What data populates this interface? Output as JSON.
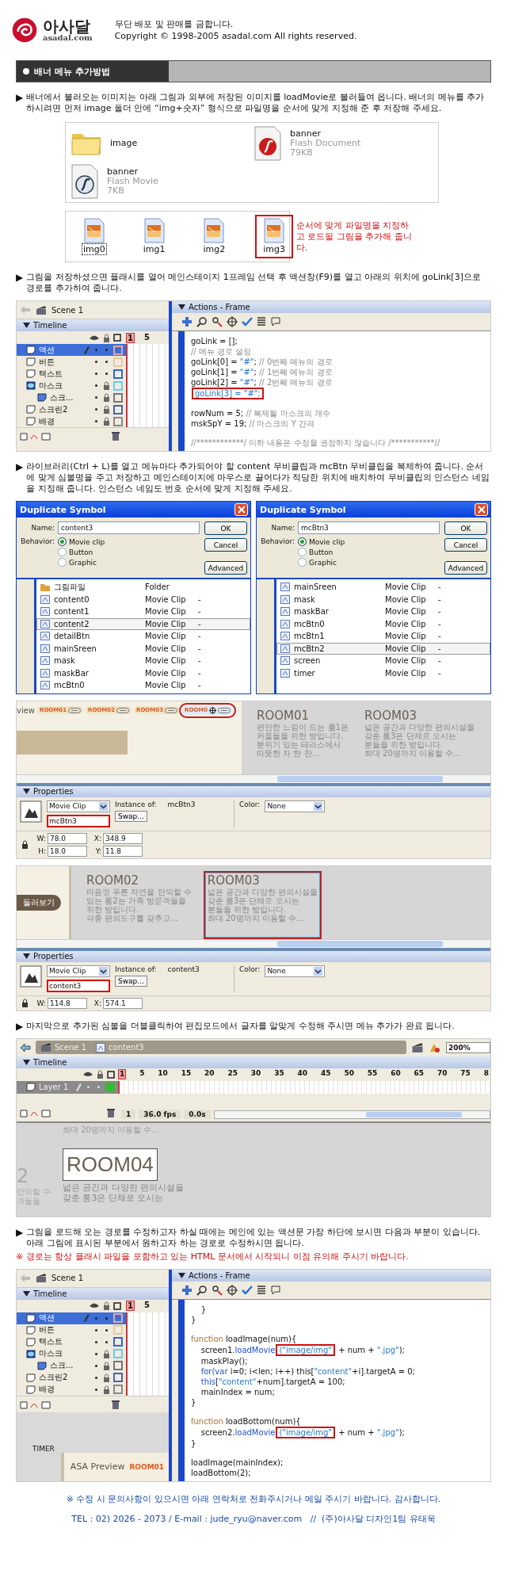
{
  "header": {
    "logo": "아사달",
    "domain": "asadal.com",
    "notice": "무단 배포 및 판매를 금합니다.",
    "copyright": "Copyright © 1998-2005 asadal.com All rights reserved."
  },
  "section_title": "배너 메뉴 추가방법",
  "steps": [
    {
      "bullet": "▶",
      "text": "배너에서 불러오는 이미지는 아래 그림과 외부에 저장된 이미지를 loadMovie로 불러들여 옵니다. 배너의 메뉴를 추가하시려면 먼저 image 폴더 안에 “img+숫자” 형식으로 파일명을 순서에 맞게 지정해 준 후 저장해 주세요.",
      "figures": [
        {
          "kind": "files",
          "items": [
            {
              "kind": "folder",
              "name": "image"
            },
            {
              "kind": "document",
              "name": "banner",
              "type": "Flash Document",
              "size": "79KB"
            },
            {
              "kind": "movie",
              "name": "banner",
              "type": "Flash Movie",
              "size": "7KB"
            }
          ]
        },
        {
          "kind": "images",
          "note": "순서에 맞게 파일명을 지정하고 로드될 그림을 추가해 줍니다.",
          "items": [
            {
              "name": "img0",
              "focused": true,
              "highlighted": false
            },
            {
              "name": "img1",
              "focused": false,
              "highlighted": false
            },
            {
              "name": "img2",
              "focused": false,
              "highlighted": false
            },
            {
              "name": "img3",
              "focused": false,
              "highlighted": true
            }
          ]
        }
      ]
    },
    {
      "bullet": "▶",
      "text": "그림을 저장하셨으면 플래시를 열어 메인스테이지 1프레임 선택 후 액션창(F9)를 열고 아래의 위치에 goLink[3]으로 경로를 추가하여 줍니다.",
      "figures": [
        {
          "kind": "flash_actions",
          "scene": "Scene 1",
          "timeline_title": "Timeline",
          "frame_marks": [
            "1",
            "5"
          ],
          "actions_title": "Actions - Frame",
          "layers": [
            {
              "name": "액션",
              "kind": "layer",
              "selected": true,
              "locked": false,
              "color": "#e0a8a8"
            },
            {
              "name": "버튼",
              "kind": "layer",
              "selected": false,
              "locked": false,
              "color": "#e8c8a0"
            },
            {
              "name": "텍스트",
              "kind": "layer",
              "selected": false,
              "locked": false,
              "color": "#3366cc"
            },
            {
              "name": "마스크",
              "kind": "mask",
              "selected": false,
              "locked": true,
              "color": "#66ccee"
            },
            {
              "name": "스크...",
              "kind": "masked",
              "selected": false,
              "locked": true,
              "color": "#777777"
            },
            {
              "name": "스크린2",
              "kind": "layer",
              "selected": false,
              "locked": true,
              "color": "#4466aa"
            },
            {
              "name": "배경",
              "kind": "layer",
              "selected": false,
              "locked": true,
              "color": "#888888"
            }
          ],
          "code": [
            {
              "segments": [
                {
                  "kind": "code",
                  "text": "goLink = [];"
                }
              ]
            },
            {
              "segments": [
                {
                  "kind": "comment",
                  "text": "// 메뉴 경로 설정"
                }
              ]
            },
            {
              "segments": [
                {
                  "kind": "code",
                  "text": "goLink[0] = "
                },
                {
                  "kind": "string",
                  "text": "\"#\""
                },
                {
                  "kind": "code",
                  "text": "; "
                },
                {
                  "kind": "comment",
                  "text": "// 0번째 메뉴의 경로"
                }
              ]
            },
            {
              "segments": [
                {
                  "kind": "code",
                  "text": "goLink[1] = "
                },
                {
                  "kind": "string",
                  "text": "\"#\""
                },
                {
                  "kind": "code",
                  "text": "; "
                },
                {
                  "kind": "comment",
                  "text": "// 1번째 메뉴의 경로"
                }
              ]
            },
            {
              "segments": [
                {
                  "kind": "code",
                  "text": "goLink[2] = "
                },
                {
                  "kind": "string",
                  "text": "\"#\""
                },
                {
                  "kind": "code",
                  "text": "; "
                },
                {
                  "kind": "comment",
                  "text": "// 2번째 메뉴의 경로"
                }
              ]
            },
            {
              "segments": [
                {
                  "kind": "boxed",
                  "text": "goLink[3] = \"#\";"
                }
              ]
            },
            {
              "gap_before": true,
              "segments": [
                {
                  "kind": "code",
                  "text": "rowNum = 5; "
                },
                {
                  "kind": "comment",
                  "text": "// 복제될 마스크의 개수"
                }
              ]
            },
            {
              "segments": [
                {
                  "kind": "code",
                  "text": "mskSpY = 19; "
                },
                {
                  "kind": "comment",
                  "text": "// 마스크의 Y 간격"
                }
              ]
            },
            {
              "gap_before": true,
              "segments": [
                {
                  "kind": "comment",
                  "text": "//************/ 이하 내용은 수정을 권장하지 않습니다 /***********//"
                }
              ]
            }
          ]
        }
      ]
    },
    {
      "bullet": "▶",
      "text": "라이브러리(Ctrl + L)를 열고 메뉴마다 추가되어야 할 content 무비클립과 mcBtn 무비클립을 복제하여 줍니다. 순서에 맞게 심볼명을 주고 저장하고 메인스테이지에 마우스로 끌어다가 적당한 위치에 배치하여 무비클립의 인스턴스 네임을 지정해 줍니다. 인스턴스 네임도 번호 순서에 맞게 지정해 주세요.",
      "figures": [
        {
          "kind": "dialogs",
          "dialogs": [
            {
              "title": "Duplicate Symbol",
              "name_label": "Name:",
              "name_value": "content3",
              "behavior_label": "Behavior:",
              "buttons": [
                "OK",
                "Cancel",
                "Advanced"
              ],
              "behaviors": [
                {
                  "label": "Movie clip",
                  "selected": true
                },
                {
                  "label": "Button",
                  "selected": false
                },
                {
                  "label": "Graphic",
                  "selected": false
                }
              ],
              "library": [
                {
                  "kind": "folder",
                  "name": "그림파일",
                  "type": "Folder",
                  "selected": false
                },
                {
                  "kind": "clip",
                  "name": "content0",
                  "type": "Movie Clip",
                  "usage": "-",
                  "selected": false
                },
                {
                  "kind": "clip",
                  "name": "content1",
                  "type": "Movie Clip",
                  "usage": "-",
                  "selected": false
                },
                {
                  "kind": "clip",
                  "name": "content2",
                  "type": "Movie Clip",
                  "usage": "-",
                  "selected": true
                },
                {
                  "kind": "clip",
                  "name": "detailBtn",
                  "type": "Movie Clip",
                  "usage": "-",
                  "selected": false
                },
                {
                  "kind": "clip",
                  "name": "mainSreen",
                  "type": "Movie Clip",
                  "usage": "-",
                  "selected": false
                },
                {
                  "kind": "clip",
                  "name": "mask",
                  "type": "Movie Clip",
                  "usage": "-",
                  "selected": false
                },
                {
                  "kind": "clip",
                  "name": "maskBar",
                  "type": "Movie Clip",
                  "usage": "-",
                  "selected": false
                },
                {
                  "kind": "clip",
                  "name": "mcBtn0",
                  "type": "Movie Clip",
                  "usage": "-",
                  "selected": false
                }
              ]
            },
            {
              "title": "Duplicate Symbol",
              "name_label": "Name:",
              "name_value": "mcBtn3",
              "behavior_label": "Behavior:",
              "buttons": [
                "OK",
                "Cancel",
                "Advanced"
              ],
              "behaviors": [
                {
                  "label": "Movie clip",
                  "selected": true
                },
                {
                  "label": "Button",
                  "selected": false
                },
                {
                  "label": "Graphic",
                  "selected": false
                }
              ],
              "library": [
                {
                  "kind": "clip",
                  "name": "mainSreen",
                  "type": "Movie Clip",
                  "usage": "-",
                  "selected": false
                },
                {
                  "kind": "clip",
                  "name": "mask",
                  "type": "Movie Clip",
                  "usage": "-",
                  "selected": false
                },
                {
                  "kind": "clip",
                  "name": "maskBar",
                  "type": "Movie Clip",
                  "usage": "-",
                  "selected": false
                },
                {
                  "kind": "clip",
                  "name": "mcBtn0",
                  "type": "Movie Clip",
                  "usage": "-",
                  "selected": false
                },
                {
                  "kind": "clip",
                  "name": "mcBtn1",
                  "type": "Movie Clip",
                  "usage": "-",
                  "selected": false
                },
                {
                  "kind": "clip",
                  "name": "mcBtn2",
                  "type": "Movie Clip",
                  "usage": "-",
                  "selected": true
                },
                {
                  "kind": "clip",
                  "name": "screen",
                  "type": "Movie Clip",
                  "usage": "-",
                  "selected": false
                },
                {
                  "kind": "clip",
                  "name": "timer",
                  "type": "Movie Clip",
                  "usage": "-",
                  "selected": false
                }
              ]
            }
          ]
        },
        {
          "kind": "stage",
          "preview": {
            "kind": "menu",
            "label": "view",
            "tabs": [
              {
                "label": "ROOM01",
                "highlighted": false
              },
              {
                "label": "ROOM02",
                "highlighted": false
              },
              {
                "label": "ROOM03",
                "highlighted": false
              },
              {
                "label": "ROOM0",
                "highlighted": true
              }
            ]
          },
          "rooms": [
            {
              "title": "ROOM01",
              "highlighted": false,
              "lines": [
                "편안한 느낌이 드는 룸1은",
                "커플들을 위한 방입니다.",
                "분위기 있는 테라스에서",
                "따뜻한 차 한 잔..."
              ]
            },
            {
              "title": "ROOM03",
              "highlighted": false,
              "lines": [
                "넓은 공간과 다양한 편의시설을",
                "갖춘 룸3은 단체로 오시는",
                "분들을 위한 방입니다.",
                "최대 20명까지 이용할 수..."
              ]
            }
          ],
          "properties": {
            "title": "Properties",
            "type": "Movie Clip",
            "instance_name": "mcBtn3",
            "instance_highlighted": true,
            "instance_of_label": "Instance of:",
            "instance_of": "mcBtn3",
            "swap": "Swap...",
            "color_label": "Color:",
            "color_value": "None",
            "metrics": [
              {
                "label": "W:",
                "value": "78.0"
              },
              {
                "label": "X:",
                "value": "348.9"
              },
              {
                "label": "H:",
                "value": "18.0"
              },
              {
                "label": "Y:",
                "value": "11.8"
              }
            ]
          }
        },
        {
          "kind": "stage",
          "preview": {
            "kind": "button",
            "label": "둘러보기"
          },
          "rooms": [
            {
              "title": "ROOM02",
              "highlighted": false,
              "lines": [
                "마음껏 푸른 자연을 만끽할 수",
                "있는 룸2는 가족 방문객들을",
                "위한 방입니다.",
                "각종 편의도구를 갖추고..."
              ]
            },
            {
              "title": "ROOM03",
              "highlighted": true,
              "lines": [
                "넓은 공간과 다양한 편의시설을",
                "갖춘 룸3은 단체로 오시는",
                "분들을 위한 방입니다.",
                "최대 20명까지 이용할 수..."
              ]
            }
          ],
          "properties": {
            "title": "Properties",
            "type": "Movie Clip",
            "instance_name": "content3",
            "instance_highlighted": true,
            "instance_of_label": "Instance of:",
            "instance_of": "content3",
            "swap": "Swap...",
            "color_label": "Color:",
            "color_value": "None",
            "metrics": [
              {
                "label": "W:",
                "value": "114.8"
              },
              {
                "label": "X:",
                "value": "574.1"
              }
            ]
          }
        }
      ]
    },
    {
      "bullet": "▶",
      "text": "마지막으로 추가된 심볼을 더블클릭하여 편집모드에서 글자를 알맞게 수정해 주시면 메뉴 추가가 완료 됩니다.",
      "figures": [
        {
          "kind": "edit_mode",
          "crumbs": [
            {
              "kind": "scene",
              "label": "Scene 1"
            },
            {
              "kind": "symbol",
              "label": "content3"
            }
          ],
          "zoom": "200%",
          "timeline_title": "Timeline",
          "frames": [
            "1",
            "5",
            "10",
            "15",
            "20",
            "25",
            "30",
            "35",
            "40",
            "45",
            "50",
            "55",
            "60",
            "65",
            "70",
            "75",
            "8"
          ],
          "layer": {
            "name": "Layer 1",
            "selected": true
          },
          "frame": "1",
          "fps": "36.0 fps",
          "time": "0.0s",
          "stage": {
            "above": "최대 20명까지 이용할 수...",
            "left_cut": [
              "2",
              "만끽할 수",
              "객들을"
            ],
            "title": "ROOM04",
            "lines": [
              "넓은 공간과 다양한 편의시설을",
              "갖춘 룸3은 단체로 오시는"
            ]
          }
        }
      ]
    },
    {
      "bullet": "▶",
      "text": "그림을 로드해 오는 경로를 수정하고자 하실 때에는 메인에 있는 액션문 가장 하단에 보시면 다음과 부분이 있습니다. 아래 그림에 표시된 부분에서 원하고자 하는 경로로 수정하시면 됩니다.",
      "warning": "※ 경로는 항상 플래시 파일을 포함하고 있는 HTML 문서에서 시작되니 이점 유의해 주시기 바랍니다.",
      "figures": [
        {
          "kind": "flash_actions",
          "scene": "Scene 1",
          "timeline_title": "Timeline",
          "frame_marks": [
            "1",
            "5"
          ],
          "actions_title": "Actions - Frame",
          "layers": [
            {
              "name": "액션",
              "kind": "layer",
              "selected": true,
              "locked": false,
              "color": "#e0a8a8"
            },
            {
              "name": "버튼",
              "kind": "layer",
              "selected": false,
              "locked": false,
              "color": "#e8c8a0"
            },
            {
              "name": "텍스트",
              "kind": "layer",
              "selected": false,
              "locked": false,
              "color": "#3366cc"
            },
            {
              "name": "마스크",
              "kind": "mask",
              "selected": false,
              "locked": true,
              "color": "#66ccee"
            },
            {
              "name": "스크...",
              "kind": "masked",
              "selected": false,
              "locked": true,
              "color": "#777777"
            },
            {
              "name": "스크린2",
              "kind": "layer",
              "selected": false,
              "locked": true,
              "color": "#4466aa"
            },
            {
              "name": "배경",
              "kind": "layer",
              "selected": false,
              "locked": true,
              "color": "#888888"
            }
          ],
          "below": {
            "label": "TIMER",
            "title": "ASA Preview",
            "tab": "ROOM01"
          },
          "code": [
            {
              "segments": [
                {
                  "kind": "code",
                  "text": "    }"
                }
              ]
            },
            {
              "segments": [
                {
                  "kind": "code",
                  "text": "}"
                }
              ]
            },
            {
              "gap_before": true,
              "segments": [
                {
                  "kind": "decl",
                  "text": "function"
                },
                {
                  "kind": "code",
                  "text": " loadImage(num){"
                }
              ]
            },
            {
              "segments": [
                {
                  "kind": "code",
                  "text": "    screen1."
                },
                {
                  "kind": "keyword",
                  "text": "loadMovie"
                },
                {
                  "kind": "boxed",
                  "text": "(\"image/img\""
                },
                {
                  "kind": "code",
                  "text": " + num + "
                },
                {
                  "kind": "string",
                  "text": "\".jpg\""
                },
                {
                  "kind": "code",
                  "text": ");"
                }
              ]
            },
            {
              "segments": [
                {
                  "kind": "code",
                  "text": "    maskPlay();"
                }
              ]
            },
            {
              "segments": [
                {
                  "kind": "keyword",
                  "text": "    for(var"
                },
                {
                  "kind": "code",
                  "text": " i=0; i<len; i++) this["
                },
                {
                  "kind": "string",
                  "text": "\"content\""
                },
                {
                  "kind": "code",
                  "text": "+i].targetA = 0;"
                }
              ]
            },
            {
              "segments": [
                {
                  "kind": "keyword",
                  "text": "    this"
                },
                {
                  "kind": "code",
                  "text": "["
                },
                {
                  "kind": "string",
                  "text": "\"content\""
                },
                {
                  "kind": "code",
                  "text": "+num].targetA = 100;"
                }
              ]
            },
            {
              "segments": [
                {
                  "kind": "code",
                  "text": "    mainIndex = num;"
                }
              ]
            },
            {
              "segments": [
                {
                  "kind": "code",
                  "text": "}"
                }
              ]
            },
            {
              "gap_before": true,
              "segments": [
                {
                  "kind": "decl",
                  "text": "function"
                },
                {
                  "kind": "code",
                  "text": " loadBottom(num){"
                }
              ]
            },
            {
              "segments": [
                {
                  "kind": "code",
                  "text": "    screen2."
                },
                {
                  "kind": "keyword",
                  "text": "loadMovie"
                },
                {
                  "kind": "boxed",
                  "text": "(\"image/img\""
                },
                {
                  "kind": "code",
                  "text": " + num + "
                },
                {
                  "kind": "string",
                  "text": "\".jpg\""
                },
                {
                  "kind": "code",
                  "text": ");"
                }
              ]
            },
            {
              "segments": [
                {
                  "kind": "code",
                  "text": "}"
                }
              ]
            },
            {
              "gap_before": true,
              "segments": [
                {
                  "kind": "code",
                  "text": "loadImage(mainIndex);"
                }
              ]
            },
            {
              "segments": [
                {
                  "kind": "code",
                  "text": "loadBottom(2);"
                }
              ]
            }
          ]
        }
      ]
    }
  ],
  "footer": {
    "note": "※ 수정 시 문의사항이 있으시면 아래 연락처로 전화주시거나 메일 주시기 바랍니다. 감사합니다.",
    "contact": "TEL : 02) 2026 - 2073 / E-mail : jude_ryu@naver.com   //  (주)아사달 디자인1팀 유태욱"
  }
}
